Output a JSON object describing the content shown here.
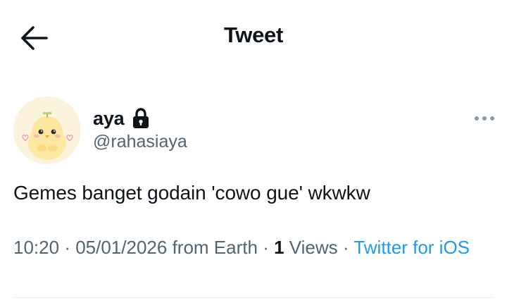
{
  "header": {
    "title": "Tweet",
    "back_icon": "arrow-left-icon"
  },
  "author": {
    "display_name": "aya",
    "handle": "@rahasiaya",
    "protected_icon": "lock-icon",
    "avatar": "chick-avatar"
  },
  "tweet": {
    "text": "Gemes banget godain 'cowo gue' wkwkw",
    "time": "10:20",
    "date": "05/01/2026",
    "location": "from Earth",
    "views_count": "1",
    "views_label": "Views",
    "source": "Twitter for iOS"
  },
  "more_icon": "more-horizontal-icon",
  "colors": {
    "text": "#0f1419",
    "secondary": "#536471",
    "link": "#1d9bf0",
    "divider": "#e6ecf0"
  }
}
